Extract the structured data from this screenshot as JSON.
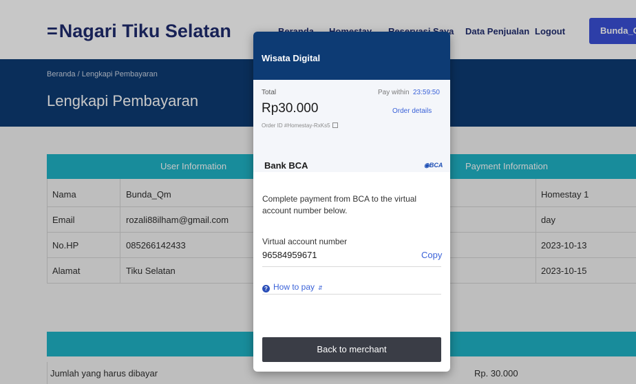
{
  "background": {
    "nav": {
      "brand_glyph": "=",
      "brand": "Nagari Tiku Selatan",
      "links": [
        "Beranda",
        "Homestay",
        "Reservasi Saya",
        "Data Penjualan",
        "Logout"
      ],
      "user_button": "Bunda_Q"
    },
    "hero": {
      "breadcrumb": "Beranda  /  Lengkapi Pembayaran",
      "title": "Lengkapi Pembayaran"
    },
    "table": {
      "user_header": "User Information",
      "payment_header": "Payment Information",
      "rows": [
        {
          "label": "Nama",
          "value": "Bunda_Qm",
          "right": "Homestay 1"
        },
        {
          "label": "Email",
          "value": "rozali88ilham@gmail.com",
          "right": "day"
        },
        {
          "label": "No.HP",
          "value": "085266142433",
          "right": "2023-10-13"
        },
        {
          "label": "Alamat",
          "value": "Tiku Selatan",
          "right": "2023-10-15"
        }
      ]
    },
    "total": {
      "label": "Jumlah yang harus dibayar",
      "value": "Rp. 30.000"
    }
  },
  "modal": {
    "merchant": "Wisata Digital",
    "total_label": "Total",
    "amount": "Rp30.000",
    "order_id": "Order ID #Homestay-RxKs5",
    "pay_within_label": "Pay within",
    "timer": "23:59:50",
    "order_details": "Order details",
    "bank_name": "Bank BCA",
    "bank_logo_text": "BCA",
    "description": "Complete payment from BCA to the virtual account number below.",
    "va_label": "Virtual account number",
    "va_number": "96584959671",
    "copy": "Copy",
    "how_to_pay": "How to pay",
    "back": "Back to merchant"
  },
  "colors": {
    "primary_navy": "#0d3b74",
    "teal_header": "#1fb4c7",
    "link_blue": "#3a62d8",
    "button_dark": "#3a3d46"
  }
}
